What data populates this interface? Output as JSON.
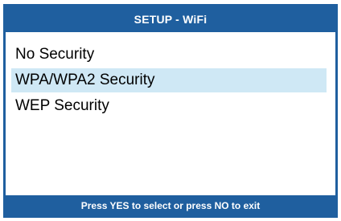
{
  "header": {
    "title": "SETUP - WiFi"
  },
  "menu": {
    "items": [
      {
        "label": "No Security",
        "selected": false
      },
      {
        "label": "WPA/WPA2 Security",
        "selected": true
      },
      {
        "label": "WEP Security",
        "selected": false
      }
    ]
  },
  "footer": {
    "hint": "Press YES to select or press NO to exit"
  },
  "colors": {
    "frame": "#1f5f9f",
    "selection": "#cfe8f5"
  }
}
